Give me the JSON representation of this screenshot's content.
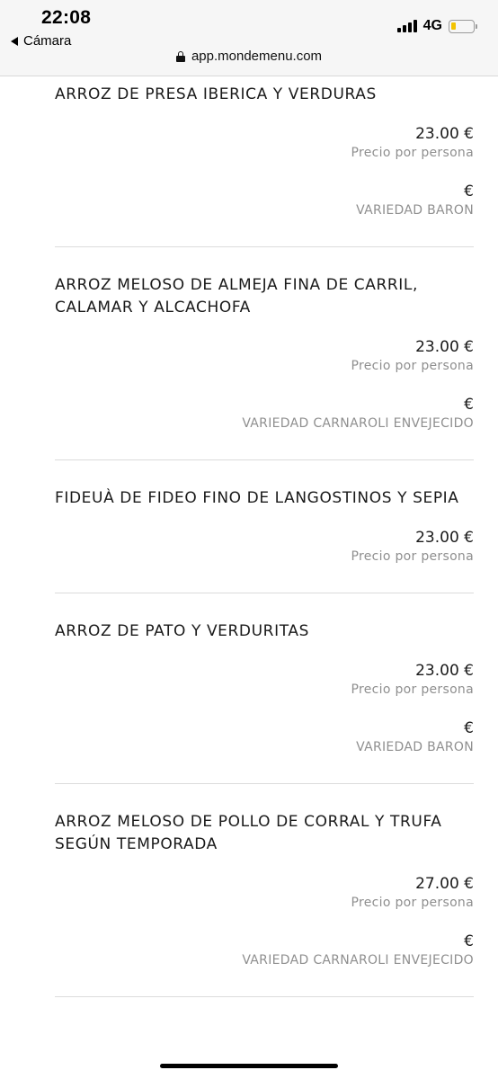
{
  "status_bar": {
    "time": "22:08",
    "back_label": "Cámara",
    "network": "4G",
    "battery_level": 0.2,
    "battery_color": "#f2c300"
  },
  "browser": {
    "url": "app.mondemenu.com",
    "lock_icon": "lock-icon"
  },
  "menu": {
    "items": [
      {
        "name": "ARROZ DE PRESA IBERICA Y VERDURAS",
        "price": "23.00 €",
        "price_note": "Precio por persona",
        "variety_price": "€",
        "variety": "VARIEDAD BARON"
      },
      {
        "name": "ARROZ MELOSO DE ALMEJA FINA DE CARRIL, CALAMAR Y ALCACHOFA",
        "price": "23.00 €",
        "price_note": "Precio por persona",
        "variety_price": "€",
        "variety": "VARIEDAD CARNAROLI ENVEJECIDO"
      },
      {
        "name": "FIDEUÀ DE FIDEO FINO DE LANGOSTINOS Y SEPIA",
        "price": "23.00 €",
        "price_note": "Precio por persona"
      },
      {
        "name": "ARROZ DE PATO Y VERDURITAS",
        "price": "23.00 €",
        "price_note": "Precio por persona",
        "variety_price": "€",
        "variety": "VARIEDAD BARON"
      },
      {
        "name": "ARROZ MELOSO DE POLLO DE CORRAL Y TRUFA SEGÚN TEMPORADA",
        "price": "27.00 €",
        "price_note": "Precio por persona",
        "variety_price": "€",
        "variety": "VARIEDAD CARNAROLI ENVEJECIDO"
      }
    ]
  }
}
